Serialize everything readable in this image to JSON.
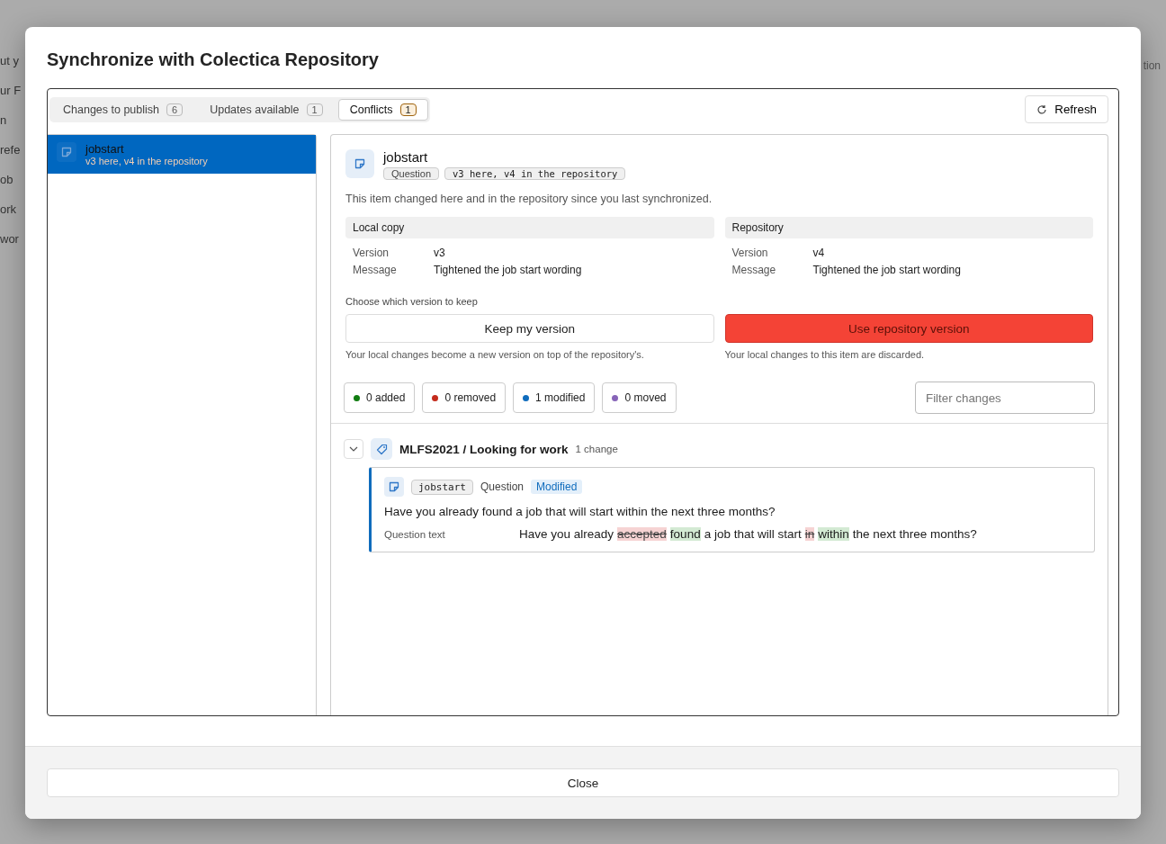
{
  "background": {
    "left_fragments": [
      "ut y",
      "ur F",
      "n",
      "refe",
      "ob",
      "ork",
      "wor"
    ],
    "right_fragments": [
      "tion"
    ]
  },
  "dialog": {
    "title": "Synchronize with Colectica Repository",
    "tabs": [
      {
        "label": "Changes to publish",
        "count": "6",
        "selected": false
      },
      {
        "label": "Updates available",
        "count": "1",
        "selected": false
      },
      {
        "label": "Conflicts",
        "count": "1",
        "selected": true
      }
    ],
    "refresh_button": "Refresh",
    "items": [
      {
        "name": "jobstart",
        "subtitle": "v3 here, v4 in the repository",
        "selected": true
      }
    ],
    "detail": {
      "name": "jobstart",
      "type_badge": "Question",
      "version_badge": "v3 here, v4 in the repository",
      "description": "This item changed here and in the repository since you last synchronized.",
      "sides": [
        {
          "heading": "Local copy",
          "rows": [
            {
              "label": "Version",
              "value": "v3"
            },
            {
              "label": "Message",
              "value": "Tightened the job start wording"
            }
          ]
        },
        {
          "heading": "Repository",
          "rows": [
            {
              "label": "Version",
              "value": "v4"
            },
            {
              "label": "Message",
              "value": "Tightened the job start wording"
            }
          ]
        }
      ],
      "choose_label": "Choose which version to keep",
      "choices": [
        {
          "label": "Keep my version",
          "note": "Your local changes become a new version on top of the repository's.",
          "selected": false
        },
        {
          "label": "Use repository version",
          "note": "Your local changes to this item are discarded.",
          "selected": true
        }
      ],
      "counts": [
        {
          "label": "0 added",
          "color": "#107c10"
        },
        {
          "label": "0 removed",
          "color": "#c42b1c"
        },
        {
          "label": "1 modified",
          "color": "#0f6cbd"
        },
        {
          "label": "0 moved",
          "color": "#8764b8"
        }
      ],
      "filter": {
        "placeholder": "Filter changes"
      },
      "group": {
        "title": "MLFS2021 / Looking for work",
        "count": "1 change",
        "expanded": true,
        "change": {
          "code": "jobstart",
          "type": "Question",
          "status": "Modified",
          "question": "Have you already found a job that will start within the next three months?",
          "field_label": "Question text",
          "diff": [
            {
              "text": "Have you already",
              "kind": "same"
            },
            {
              "text": "accepted",
              "kind": "removed"
            },
            {
              "text": "found",
              "kind": "added"
            },
            {
              "text": "a job that will start",
              "kind": "same"
            },
            {
              "text": "in",
              "kind": "removed"
            },
            {
              "text": "within",
              "kind": "added"
            },
            {
              "text": "the next three months?",
              "kind": "same"
            }
          ]
        }
      }
    },
    "close_button": "Close"
  }
}
